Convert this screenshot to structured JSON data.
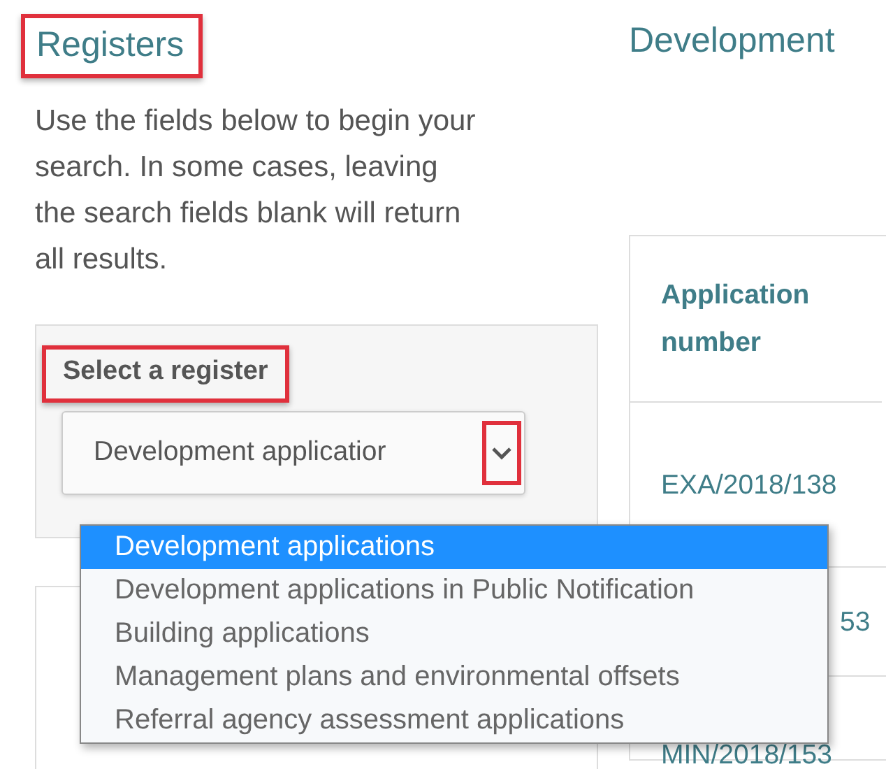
{
  "sidebar": {
    "title": "Registers",
    "title_highlighted": true,
    "intro": "Use the fields below to begin your search. In some cases, leaving the search fields blank will return all results.",
    "register_label": "Select a register",
    "label_highlighted": true,
    "register_select": {
      "value": "Development applicatior",
      "expanded": true,
      "caret_highlighted": true,
      "options": [
        {
          "label": "Development applications",
          "selected": true
        },
        {
          "label": "Development applications in Public Notification",
          "selected": false
        },
        {
          "label": "Building applications",
          "selected": false
        },
        {
          "label": "Management plans and environmental offsets",
          "selected": false
        },
        {
          "label": "Referral agency assessment applications",
          "selected": false
        }
      ]
    }
  },
  "main": {
    "title": "Development",
    "table": {
      "columns": [
        "Application number"
      ],
      "rows": [
        [
          "EXA/2018/138"
        ],
        [
          "53"
        ],
        [
          "MIN/2018/153"
        ]
      ]
    }
  }
}
